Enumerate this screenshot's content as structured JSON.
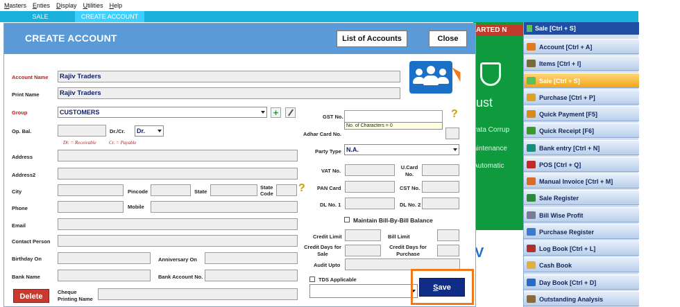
{
  "menubar": [
    "Masters",
    "Enties",
    "Display",
    "Utilities",
    "Help"
  ],
  "tabs": {
    "sale": "SALE",
    "create": "CREATE ACCOUNT"
  },
  "background": {
    "banner": "ARTED N",
    "text_big": "ust",
    "text1": "vata Corrup",
    "text2": "aintenance",
    "text3": "Automatic",
    "text4": "V"
  },
  "dialog": {
    "title": "CREATE ACCOUNT",
    "list_button": "List of Accounts",
    "close_button": "Close",
    "delete_button": "Delete",
    "save_button": "Save"
  },
  "form": {
    "account_name_label": "Account Name",
    "account_name": "Rajiv Traders",
    "print_name_label": "Print Name",
    "print_name": "Rajiv Traders",
    "group_label": "Group",
    "group": "CUSTOMERS",
    "opbal_label": "Op. Bal.",
    "opbal": "",
    "drcr_label": "Dr./Cr.",
    "drcr": "Dr.",
    "dr_hint": "Dr. = Receivable",
    "cr_hint": "Cr. = Payable",
    "address_label": "Address",
    "address2_label": "Address2",
    "city_label": "City",
    "pincode_label": "Pincode",
    "state_label": "State",
    "state_code_label": "State Code",
    "phone_label": "Phone",
    "mobile_label": "Mobile",
    "email_label": "Email",
    "contact_label": "Contact Person",
    "birthday_label": "Birthday On",
    "anniversary_label": "Anniversary On",
    "bank_label": "Bank Name",
    "bank_ac_label": "Bank Account No.",
    "cheque_label": "Cheque Printing Name",
    "gst_label": "GST No.",
    "gst_tooltip": "No. of Characters = 0",
    "adhar_label": "Adhar Card No.",
    "party_type_label": "Party Type",
    "party_type": "N.A.",
    "vat_label": "VAT No.",
    "ucard_label": "U.Card No.",
    "pan_label": "PAN Card",
    "cst_label": "CST No.",
    "dl1_label": "DL No. 1",
    "dl2_label": "DL No. 2",
    "maintain_label": "Maintain Bill-By-Bill Balance",
    "credit_limit_label": "Credit Limit",
    "bill_limit_label": "Bill Limit",
    "credit_days_sale_label": "Credit Days for Sale",
    "credit_days_purchase_label": "Credit Days for Purchase",
    "audit_label": "Audit Upto",
    "tds_label": "TDS Applicable"
  },
  "shortcuts": {
    "header": "Sale [Ctrl + S]",
    "items": [
      "Account [Ctrl + A]",
      "Items [Ctrl + I]",
      "Sale [Ctrl + S]",
      "Purchase [Ctrl + P]",
      "Quick Payment [F5]",
      "Quick Receipt [F6]",
      "Bank entry [Ctrl + N]",
      "POS [Ctrl + Q]",
      "Manual Invoice [Ctrl + M]",
      "Sale Register",
      "Bill Wise Profit",
      "Purchase Register",
      "Log Book [Ctrl + L]",
      "Cash Book",
      "Day Book [Ctrl + D]",
      "Outstanding Analysis"
    ],
    "active_index": 2,
    "icon_colors": [
      "#e07a20",
      "#7a6a3a",
      "#5cc05a",
      "#e0a020",
      "#d88a1a",
      "#3a9a2a",
      "#1a8a7a",
      "#c02a2a",
      "#d86a2a",
      "#2a8a3a",
      "#7a7a9a",
      "#3a7ad0",
      "#b0302a",
      "#e0b040",
      "#2a6ac0",
      "#8a6a3a"
    ]
  }
}
